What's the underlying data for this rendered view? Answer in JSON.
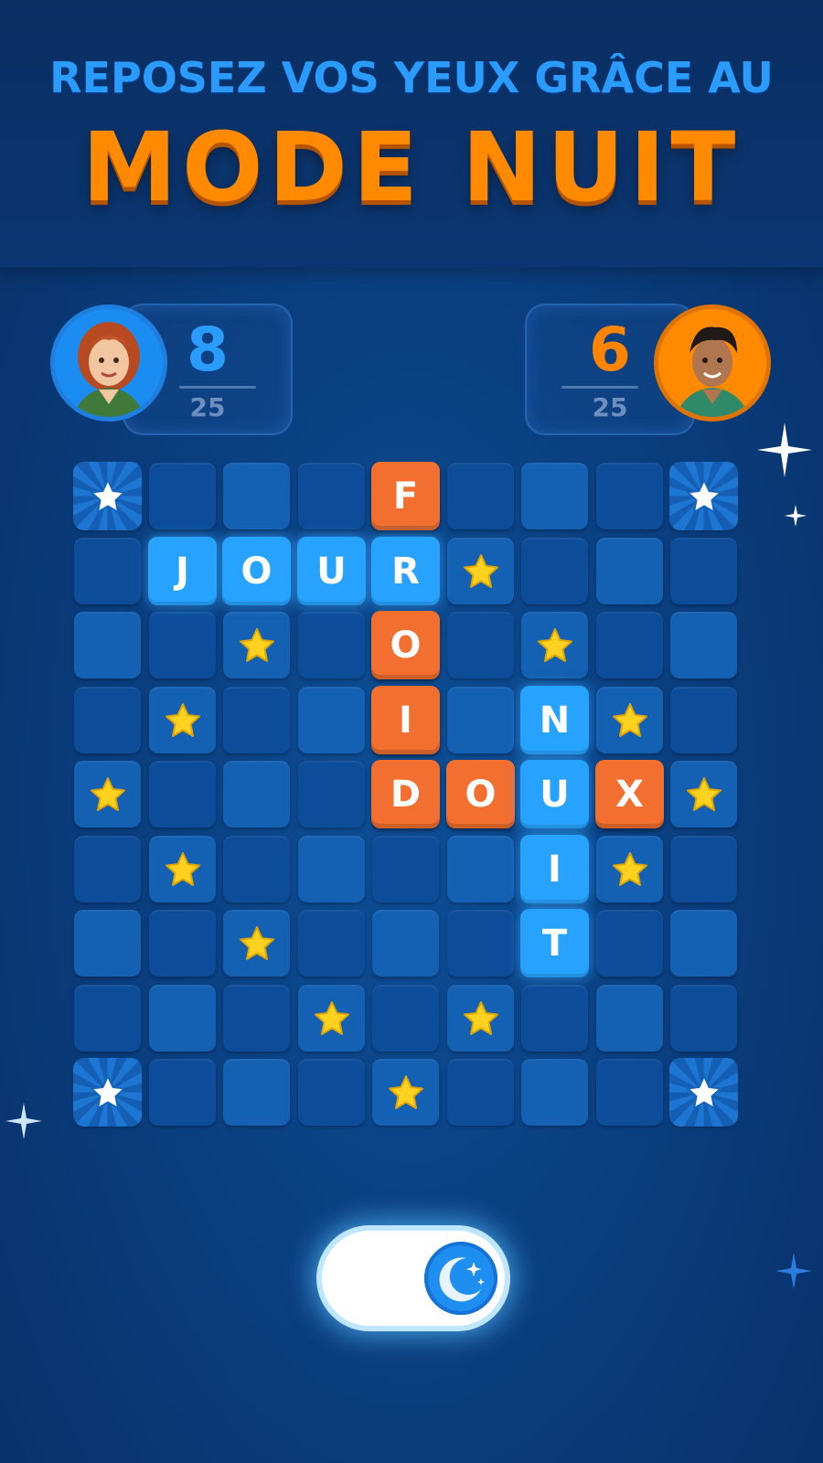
{
  "headline": {
    "line1": "REPOSEZ VOS YEUX GRÂCE AU",
    "line2": "MODE NUIT"
  },
  "players": [
    {
      "score": "8",
      "total": "25",
      "color": "#2a9bff"
    },
    {
      "score": "6",
      "total": "25",
      "color": "#ff8400"
    }
  ],
  "board": {
    "size": 9,
    "tiles": [
      {
        "row": 0,
        "col": 4,
        "letter": "F",
        "color": "orange"
      },
      {
        "row": 1,
        "col": 1,
        "letter": "J",
        "color": "blue"
      },
      {
        "row": 1,
        "col": 2,
        "letter": "O",
        "color": "blue"
      },
      {
        "row": 1,
        "col": 3,
        "letter": "U",
        "color": "blue"
      },
      {
        "row": 1,
        "col": 4,
        "letter": "R",
        "color": "blue"
      },
      {
        "row": 2,
        "col": 4,
        "letter": "O",
        "color": "orange"
      },
      {
        "row": 3,
        "col": 4,
        "letter": "I",
        "color": "orange"
      },
      {
        "row": 3,
        "col": 6,
        "letter": "N",
        "color": "blue"
      },
      {
        "row": 4,
        "col": 4,
        "letter": "D",
        "color": "orange"
      },
      {
        "row": 4,
        "col": 5,
        "letter": "O",
        "color": "orange"
      },
      {
        "row": 4,
        "col": 6,
        "letter": "U",
        "color": "blue"
      },
      {
        "row": 4,
        "col": 7,
        "letter": "X",
        "color": "orange"
      },
      {
        "row": 5,
        "col": 6,
        "letter": "I",
        "color": "blue"
      },
      {
        "row": 6,
        "col": 6,
        "letter": "T",
        "color": "blue"
      }
    ],
    "stars": [
      [
        1,
        5
      ],
      [
        2,
        2
      ],
      [
        2,
        6
      ],
      [
        3,
        1
      ],
      [
        3,
        7
      ],
      [
        4,
        0
      ],
      [
        4,
        8
      ],
      [
        5,
        1
      ],
      [
        5,
        7
      ],
      [
        6,
        2
      ],
      [
        7,
        3
      ],
      [
        7,
        5
      ],
      [
        8,
        4
      ]
    ],
    "corners": [
      [
        0,
        0
      ],
      [
        0,
        8
      ],
      [
        8,
        0
      ],
      [
        8,
        8
      ]
    ]
  },
  "night_mode_toggle": {
    "state": "on",
    "icon": "moon-icon"
  },
  "colors": {
    "background": "#0a3f80",
    "tile_blue": "#27a3ff",
    "tile_orange": "#f26f30",
    "star": "#ffd21f"
  }
}
